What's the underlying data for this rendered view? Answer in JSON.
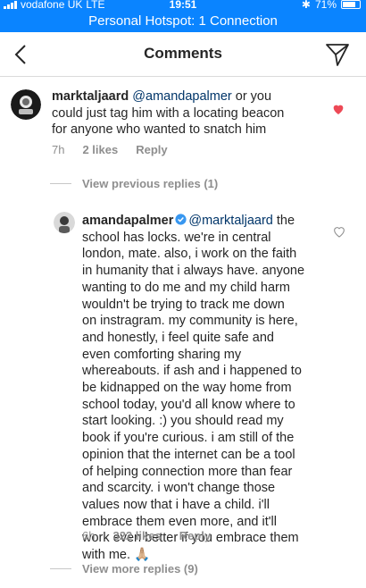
{
  "status": {
    "carrier": "vodafone UK",
    "network": "LTE",
    "time": "19:51",
    "battery": "71%"
  },
  "hotspot": {
    "label": "Personal Hotspot: 1 Connection"
  },
  "nav": {
    "title": "Comments"
  },
  "comments": [
    {
      "username": "marktaljaard",
      "mention": "@amandapalmer",
      "lines": [
        " or you",
        "could just tag him with a locating beacon",
        "for anyone who wanted to snatch him"
      ],
      "time": "7h",
      "likes": "2 likes",
      "reply": "Reply",
      "liked": true
    },
    {
      "username": "amandapalmer",
      "mention": "@marktaljaard",
      "lines": [
        " the",
        "school has locks. we're in central",
        "london, mate. also, i work on the faith",
        "in humanity that i always have. anyone",
        "wanting to do me and my child harm",
        "wouldn't be trying to track me down",
        "on instragram. my community is here,",
        "and honestly, i feel quite safe and",
        "even comforting sharing my",
        "whereabouts. if ash and i happened to",
        "be kidnapped on the way home from",
        "school today, you'd all know where to",
        "start looking. :) you should read my",
        "book if you're curious. i am still of the",
        "opinion that the internet can be a tool",
        "of helping connection more than fear",
        "and scarcity. i won't change those",
        "values now that i have a child. i'll",
        "embrace them even more, and it'll",
        "work even better if you embrace them",
        "with me. 🙏🏼"
      ],
      "time": "6h",
      "likes": "322 likes",
      "reply": "Reply",
      "liked": false
    }
  ],
  "view_previous": "View previous replies (1)",
  "view_more": "View more replies (9)",
  "colors": {
    "status_bar": "#0a84ff",
    "mention": "#003569",
    "heart_liked": "#ed4956",
    "meta": "#8e8e8e"
  }
}
